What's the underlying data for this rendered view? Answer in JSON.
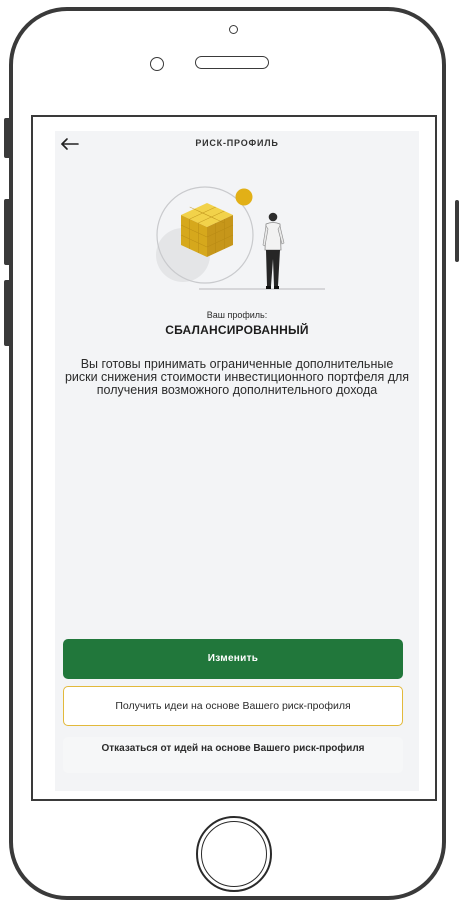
{
  "header": {
    "title": "РИСК-ПРОФИЛЬ",
    "back_icon": "arrow-left-icon"
  },
  "profile": {
    "caption": "Ваш профиль:",
    "name": "СБАЛАНСИРОВАННЫЙ",
    "description": "Вы готовы принимать ограниченные дополнительные риски снижения стоимости инвестиционного портфеля для получения возможного дополнительного дохода"
  },
  "actions": {
    "change_label": "Изменить",
    "get_ideas_label": "Получить идеи на основе Вашего риск-профиля",
    "decline_ideas_label": "Отказаться от идей на основе Вашего риск-профиля"
  },
  "colors": {
    "primary_green": "#21773b",
    "accent_gold": "#e2b93b",
    "app_background": "#f3f4f6"
  }
}
